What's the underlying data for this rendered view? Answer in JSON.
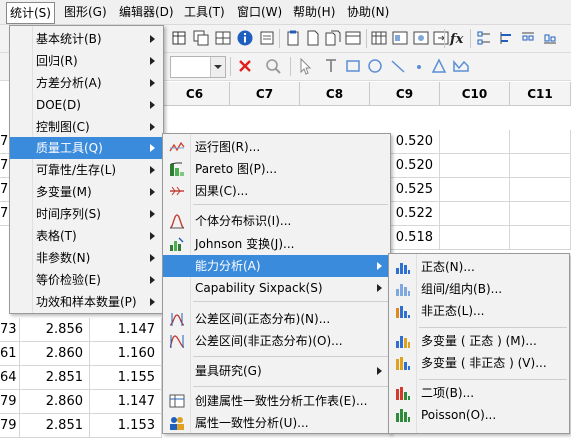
{
  "menubar": {
    "items": [
      "统计(S)",
      "图形(G)",
      "编辑器(D)",
      "工具(T)",
      "窗口(W)",
      "帮助(H)",
      "协助(N)"
    ]
  },
  "grid": {
    "columns": [
      "C6",
      "C7",
      "C8",
      "C9",
      "C10",
      "C11"
    ],
    "c9_values": [
      "0.520",
      "0.520",
      "0.525",
      "0.522",
      "0.518"
    ],
    "left_rows": [
      {
        "idx": "73",
        "a": "2.856",
        "b": "1.147"
      },
      {
        "idx": "61",
        "a": "2.860",
        "b": "1.160"
      },
      {
        "idx": "64",
        "a": "2.851",
        "b": "1.155"
      },
      {
        "idx": "79",
        "a": "2.860",
        "b": "1.147"
      },
      {
        "idx": "79",
        "a": "2.851",
        "b": "1.153"
      }
    ],
    "left_stub": [
      "7",
      "7",
      "7",
      "7"
    ]
  },
  "stat_menu": {
    "items": [
      "基本统计(B)",
      "回归(R)",
      "方差分析(A)",
      "DOE(D)",
      "控制图(C)",
      "质量工具(Q)",
      "可靠性/生存(L)",
      "多变量(M)",
      "时间序列(S)",
      "表格(T)",
      "非参数(N)",
      "等价检验(E)",
      "功效和样本数量(P)"
    ]
  },
  "quality_menu": {
    "items": [
      {
        "label": "运行图(R)...",
        "icon": "run-chart-icon"
      },
      {
        "label": "Pareto 图(P)...",
        "icon": "pareto-icon"
      },
      {
        "label": "因果(C)...",
        "icon": "fishbone-icon"
      },
      {
        "label": "个体分布标识(I)...",
        "icon": "distribution-id-icon"
      },
      {
        "label": "Johnson 变换(J)...",
        "icon": "johnson-icon"
      },
      {
        "label": "能力分析(A)",
        "icon": ""
      },
      {
        "label": "Capability Sixpack(S)",
        "icon": ""
      },
      {
        "label": "公差区间(正态分布)(N)...",
        "icon": "tolerance-normal-icon"
      },
      {
        "label": "公差区间(非正态分布)(O)...",
        "icon": "tolerance-nonnormal-icon"
      },
      {
        "label": "量具研究(G)",
        "icon": ""
      },
      {
        "label": "创建属性一致性分析工作表(E)...",
        "icon": "worksheet-icon"
      },
      {
        "label": "属性一致性分析(U)...",
        "icon": "attribute-agreement-icon"
      }
    ]
  },
  "capability_menu": {
    "items": [
      {
        "label": "正态(N)...",
        "icon": "capability-normal-icon"
      },
      {
        "label": "组间/组内(B)...",
        "icon": "capability-between-within-icon"
      },
      {
        "label": "非正态(L)...",
        "icon": "capability-nonnormal-icon"
      },
      {
        "label": "多变量 ( 正态 ) (M)...",
        "icon": "multivariate-normal-icon"
      },
      {
        "label": "多变量 ( 非正态 ) (V)...",
        "icon": "multivariate-nonnormal-icon"
      },
      {
        "label": "二项(B)...",
        "icon": "binomial-icon"
      },
      {
        "label": "Poisson(O)...",
        "icon": "poisson-icon"
      }
    ]
  },
  "colors": {
    "highlight": "#3b8bdc",
    "menu_bg": "#f2f2f2"
  }
}
